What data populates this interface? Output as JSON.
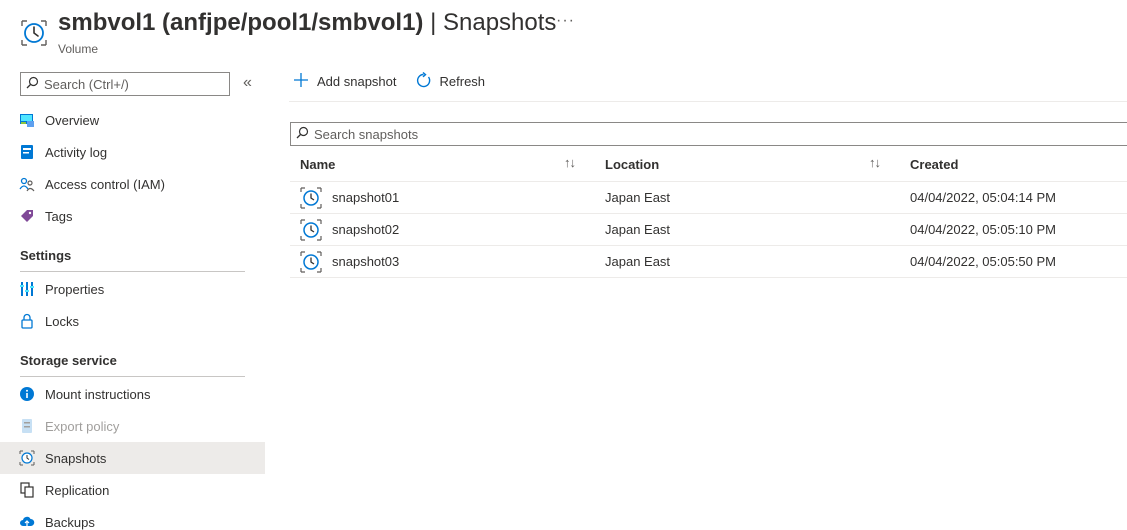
{
  "header": {
    "resource_name": "smbvol1 (anfjpe/pool1/smbvol1)",
    "separator": "|",
    "page_name": "Snapshots",
    "subtitle": "Volume",
    "more": "···"
  },
  "sidebar": {
    "search_placeholder": "Search (Ctrl+/)",
    "collapse": "«",
    "items": [
      {
        "label": "Overview",
        "icon": "overview-icon"
      },
      {
        "label": "Activity log",
        "icon": "activity-log-icon"
      },
      {
        "label": "Access control (IAM)",
        "icon": "access-control-icon"
      },
      {
        "label": "Tags",
        "icon": "tag-icon"
      }
    ],
    "sections": [
      {
        "title": "Settings",
        "items": [
          {
            "label": "Properties",
            "icon": "properties-icon"
          },
          {
            "label": "Locks",
            "icon": "lock-icon"
          }
        ]
      },
      {
        "title": "Storage service",
        "items": [
          {
            "label": "Mount instructions",
            "icon": "info-icon"
          },
          {
            "label": "Export policy",
            "icon": "export-policy-icon",
            "disabled": true
          },
          {
            "label": "Snapshots",
            "icon": "snapshot-icon",
            "active": true
          },
          {
            "label": "Replication",
            "icon": "replication-icon"
          },
          {
            "label": "Backups",
            "icon": "backup-icon"
          }
        ]
      }
    ]
  },
  "toolbar": {
    "add_snapshot": "Add snapshot",
    "refresh": "Refresh"
  },
  "search": {
    "placeholder": "Search snapshots"
  },
  "table": {
    "columns": [
      "Name",
      "Location",
      "Created"
    ],
    "sort_glyph": "↑↓",
    "rows": [
      {
        "name": "snapshot01",
        "location": "Japan East",
        "created": "04/04/2022, 05:04:14 PM"
      },
      {
        "name": "snapshot02",
        "location": "Japan East",
        "created": "04/04/2022, 05:05:10 PM"
      },
      {
        "name": "snapshot03",
        "location": "Japan East",
        "created": "04/04/2022, 05:05:50 PM"
      }
    ]
  },
  "colors": {
    "accent": "#0078d4",
    "active_bg": "#edebe9",
    "text": "#323130",
    "disabled": "#a19f9d"
  }
}
